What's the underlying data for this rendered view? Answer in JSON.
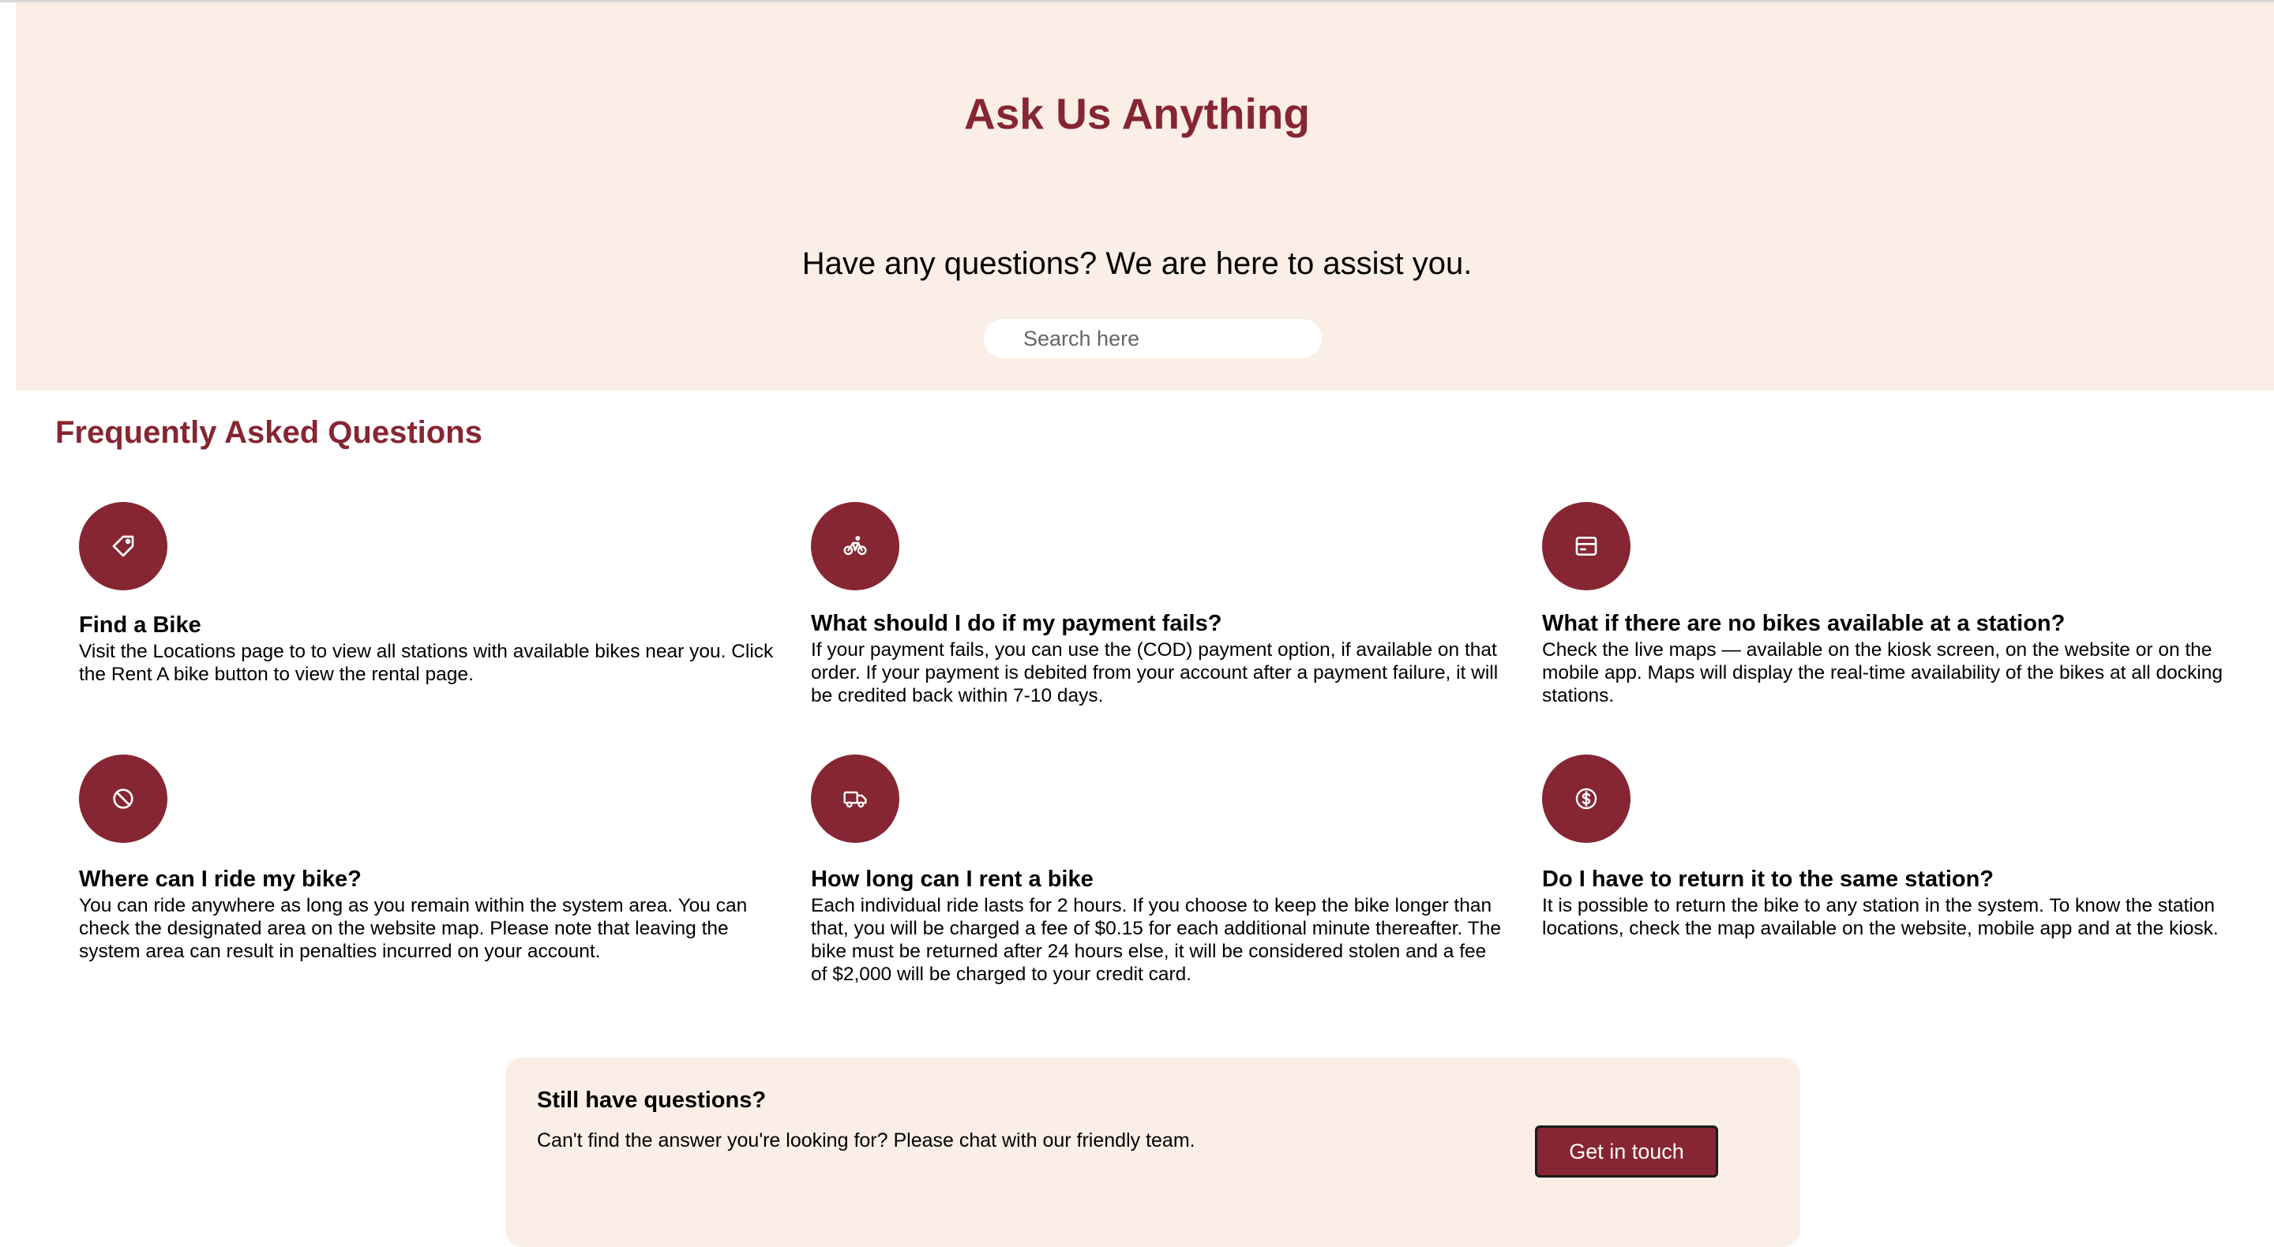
{
  "hero": {
    "title": "Ask Us Anything",
    "subtitle": "Have any questions? We are here to assist you.",
    "search_placeholder": "Search here"
  },
  "faq": {
    "heading": "Frequently Asked Questions",
    "items": [
      {
        "icon": "tag-icon",
        "question": "Find a Bike",
        "answer": "Visit the Locations page to to view all stations with available bikes near you. Click the Rent A bike button to view the rental page."
      },
      {
        "icon": "bicycle-icon",
        "question": "What should I do if my payment fails?",
        "answer": "If your payment fails, you can use the (COD) payment option, if available on that order. If your payment is debited from your account after a payment failure, it will be credited back within 7-10 days."
      },
      {
        "icon": "credit-card-icon",
        "question": "What if there are no bikes available at a station?",
        "answer": "Check the live maps — available on the kiosk screen, on the website or on the mobile app. Maps will display the real-time availability of the bikes at all docking stations."
      },
      {
        "icon": "ban-icon",
        "question": "Where can I ride my bike?",
        "answer": "You can ride anywhere as long as you remain within the system area. You can check the designated area on the website map. Please note that leaving the system area can result in penalties incurred on your account."
      },
      {
        "icon": "truck-icon",
        "question": "How long can I rent a bike",
        "answer": "Each individual ride lasts for 2 hours. If you choose to keep the bike longer than that, you will be charged a fee of $0.15 for each additional minute thereafter. The bike must be returned after 24 hours else, it will be considered stolen and a fee of $2,000 will be charged to your credit card."
      },
      {
        "icon": "dollar-coin-icon",
        "question": "Do I have to return it to the same station?",
        "answer": "It is possible to return the bike to any station in the system. To know the station locations, check the map available on the website, mobile app and at the kiosk."
      }
    ]
  },
  "cta": {
    "title": "Still have questions?",
    "text": "Can't find the answer you're looking for? Please chat with our friendly team.",
    "button_label": "Get in touch"
  },
  "colors": {
    "accent": "#862632",
    "hero_background": "#faeee6"
  }
}
